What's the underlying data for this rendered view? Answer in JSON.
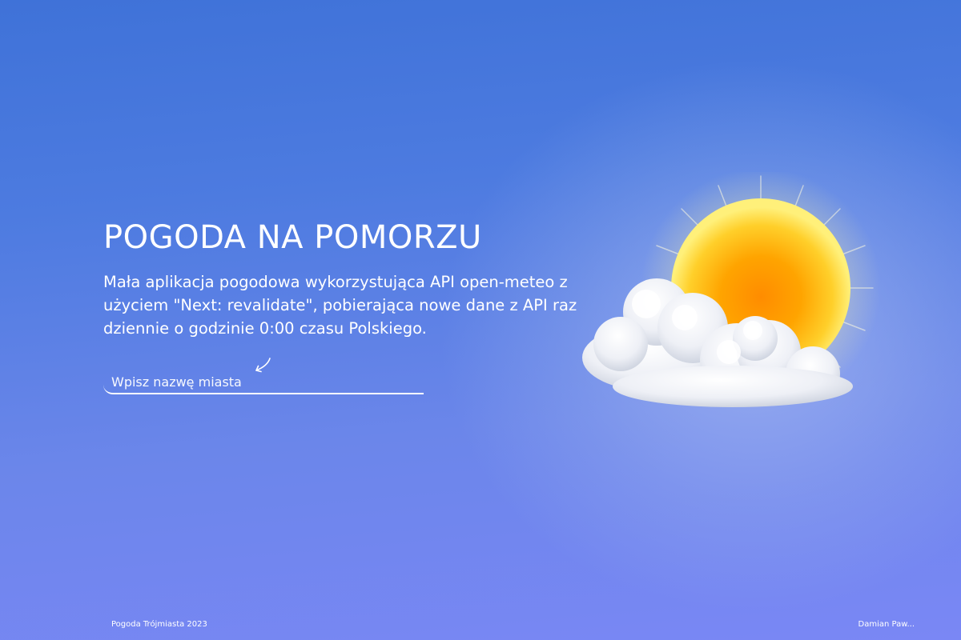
{
  "hero": {
    "title": "POGODA NA POMORZU",
    "description": "Mała aplikacja pogodowa wykorzystująca API open-meteo z użyciem \"Next: revalidate\", pobierająca nowe dane z API raz dziennie o godzinie 0:00 czasu Polskiego."
  },
  "search": {
    "placeholder": "Wpisz nazwę miasta",
    "value": ""
  },
  "footer": {
    "left": "Pogoda Trójmiasta 2023",
    "right": "Damian Paw..."
  },
  "icons": {
    "search_hint": "curved-arrow-icon",
    "weather": "sun-behind-cloud-icon"
  },
  "colors": {
    "text": "#ffffff",
    "background_top": "#3f72d8",
    "background_bottom": "#7a87f5",
    "sun_core": "#ff9a00",
    "sun_rim": "#ffe45c"
  }
}
